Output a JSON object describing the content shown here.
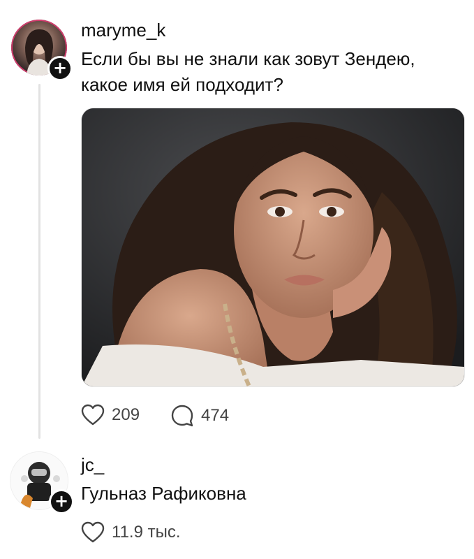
{
  "post": {
    "username": "maryme_k",
    "text_line1": "Если бы вы не знали как зовут Зендею,",
    "text_line2": "какое имя ей подходит?",
    "likes": "209",
    "comments": "474",
    "follow_symbol": "+"
  },
  "reply": {
    "username": "jc_",
    "text": "Гульназ Рафиковна",
    "likes": "11.9 тыс.",
    "follow_symbol": "+"
  },
  "icons": {
    "like": "heart-icon",
    "comment": "speech-bubble-icon",
    "follow": "plus-icon"
  },
  "colors": {
    "text": "#111111",
    "muted": "#444444",
    "thread_line": "#e2e2e2",
    "badge": "#111111"
  }
}
